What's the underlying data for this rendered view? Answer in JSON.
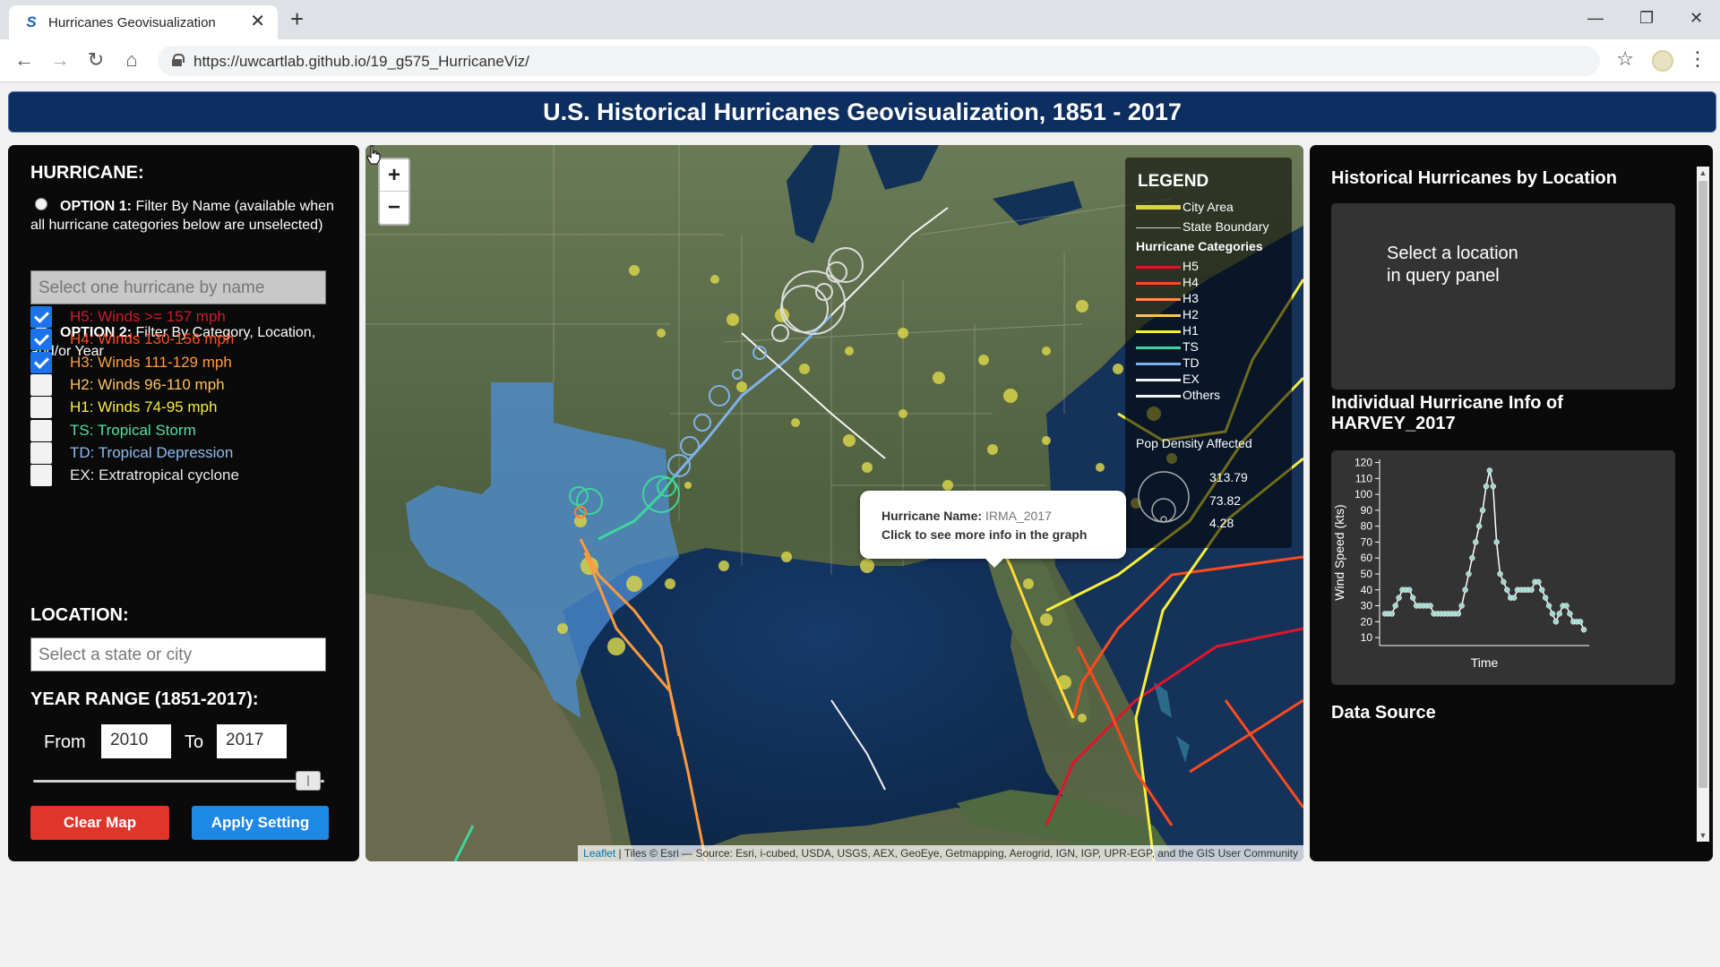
{
  "browser": {
    "tab_title": "Hurricanes Geovisualization",
    "tab_close": "✕",
    "new_tab": "+",
    "url": "https://uwcartlab.github.io/19_g575_HurricaneViz/",
    "minimize": "—",
    "maximize": "❐",
    "close": "✕"
  },
  "header": {
    "title": "U.S. Historical Hurricanes Geovisualization, 1851 - 2017"
  },
  "left_panel": {
    "hurricane_heading": "HURRICANE:",
    "option1_bold": "OPTION 1:",
    "option1_text": " Filter By Name (available when all hurricane categories below are unselected)",
    "name_placeholder": "Select one hurricane by name",
    "option2_bold": "OPTION 2:",
    "option2_text": " Filter By Category, Location, and/or Year",
    "categories": [
      {
        "label": "H5: Winds >= 157 mph",
        "checked": true,
        "color": "#d11a2a"
      },
      {
        "label": "H4: Winds 130-156 mph",
        "checked": true,
        "color": "#ff4a1c"
      },
      {
        "label": "H3: Winds 111-129 mph",
        "checked": true,
        "color": "#ff9a3c"
      },
      {
        "label": "H2: Winds 96-110 mph",
        "checked": false,
        "color": "#ffc35a"
      },
      {
        "label": "H1: Winds 74-95 mph",
        "checked": false,
        "color": "#f7ee3b"
      },
      {
        "label": "TS: Tropical Storm",
        "checked": false,
        "color": "#54e0a4"
      },
      {
        "label": "TD: Tropical Depression",
        "checked": false,
        "color": "#8fbcf0"
      },
      {
        "label": "EX: Extratropical cyclone",
        "checked": false,
        "color": "#e8e8e8"
      }
    ],
    "location_heading": "LOCATION:",
    "location_placeholder": "Select a state or city",
    "year_heading": "YEAR RANGE (1851-2017):",
    "from_label": "From",
    "from_value": "2010",
    "to_label": "To",
    "to_value": "2017",
    "clear_label": "Clear Map",
    "apply_label": "Apply Setting"
  },
  "map": {
    "zoom_in": "+",
    "zoom_out": "−",
    "legend": {
      "title": "LEGEND",
      "city_area": "City Area",
      "state_boundary": "State Boundary",
      "categories_title": "Hurricane Categories",
      "categories": [
        {
          "label": "H5",
          "color": "#e0152b"
        },
        {
          "label": "H4",
          "color": "#ff4a1c"
        },
        {
          "label": "H3",
          "color": "#ff8f3a"
        },
        {
          "label": "H2",
          "color": "#ffc35a"
        },
        {
          "label": "H1",
          "color": "#f7ee3b"
        },
        {
          "label": "TS",
          "color": "#3ed69c"
        },
        {
          "label": "TD",
          "color": "#7fb2ea"
        },
        {
          "label": "EX",
          "color": "#f4f4f4"
        },
        {
          "label": "Others",
          "color": "#f4f4f4"
        }
      ],
      "pop_density": "Pop Density Affected",
      "pop_values": [
        "313.79",
        "73.82",
        "4.28"
      ]
    },
    "popup": {
      "name_label": "Hurricane Name:",
      "name_value": "IRMA_2017",
      "hint": "Click to see more info in the graph"
    },
    "attribution_link": "Leaflet",
    "attribution_text": " | Tiles © Esri — Source: Esri, i-cubed, USDA, USGS, AEX, GeoEye, Getmapping, Aerogrid, IGN, IGP, UPR-EGP, and the GIS User Community"
  },
  "right_panel": {
    "location_title": "Historical Hurricanes by Location",
    "location_msg_line1": "Select a location",
    "location_msg_line2": "in query panel",
    "info_title_line1": "Individual Hurricane Info of",
    "info_title_line2": "HARVEY_2017",
    "data_source_title": "Data Source"
  },
  "chart_data": {
    "type": "line",
    "title": "",
    "xlabel": "Time",
    "ylabel": "Wind Speed (kts)",
    "ylim": [
      5,
      122
    ],
    "yticks": [
      10,
      20,
      30,
      40,
      50,
      60,
      70,
      80,
      90,
      100,
      110,
      120
    ],
    "x": [
      1,
      2,
      3,
      4,
      5,
      6,
      7,
      8,
      9,
      10,
      11,
      12,
      13,
      14,
      15,
      16,
      17,
      18,
      19,
      20,
      21,
      22,
      23,
      24,
      25,
      26,
      27,
      28,
      29,
      30,
      31,
      32,
      33,
      34,
      35,
      36,
      37,
      38,
      39,
      40,
      41,
      42,
      43,
      44,
      45,
      46,
      47,
      48,
      49,
      50,
      51,
      52,
      53,
      54,
      55,
      56,
      57,
      58
    ],
    "series": [
      {
        "values": [
          25,
          25,
          25,
          30,
          35,
          40,
          40,
          40,
          35,
          30,
          30,
          30,
          30,
          30,
          25,
          25,
          25,
          25,
          25,
          25,
          25,
          25,
          30,
          40,
          50,
          60,
          70,
          80,
          90,
          105,
          115,
          105,
          70,
          50,
          45,
          40,
          35,
          35,
          40,
          40,
          40,
          40,
          40,
          45,
          45,
          40,
          35,
          30,
          25,
          20,
          25,
          30,
          30,
          25,
          20,
          20,
          20,
          15
        ],
        "color": "#9fd8d0"
      }
    ]
  }
}
